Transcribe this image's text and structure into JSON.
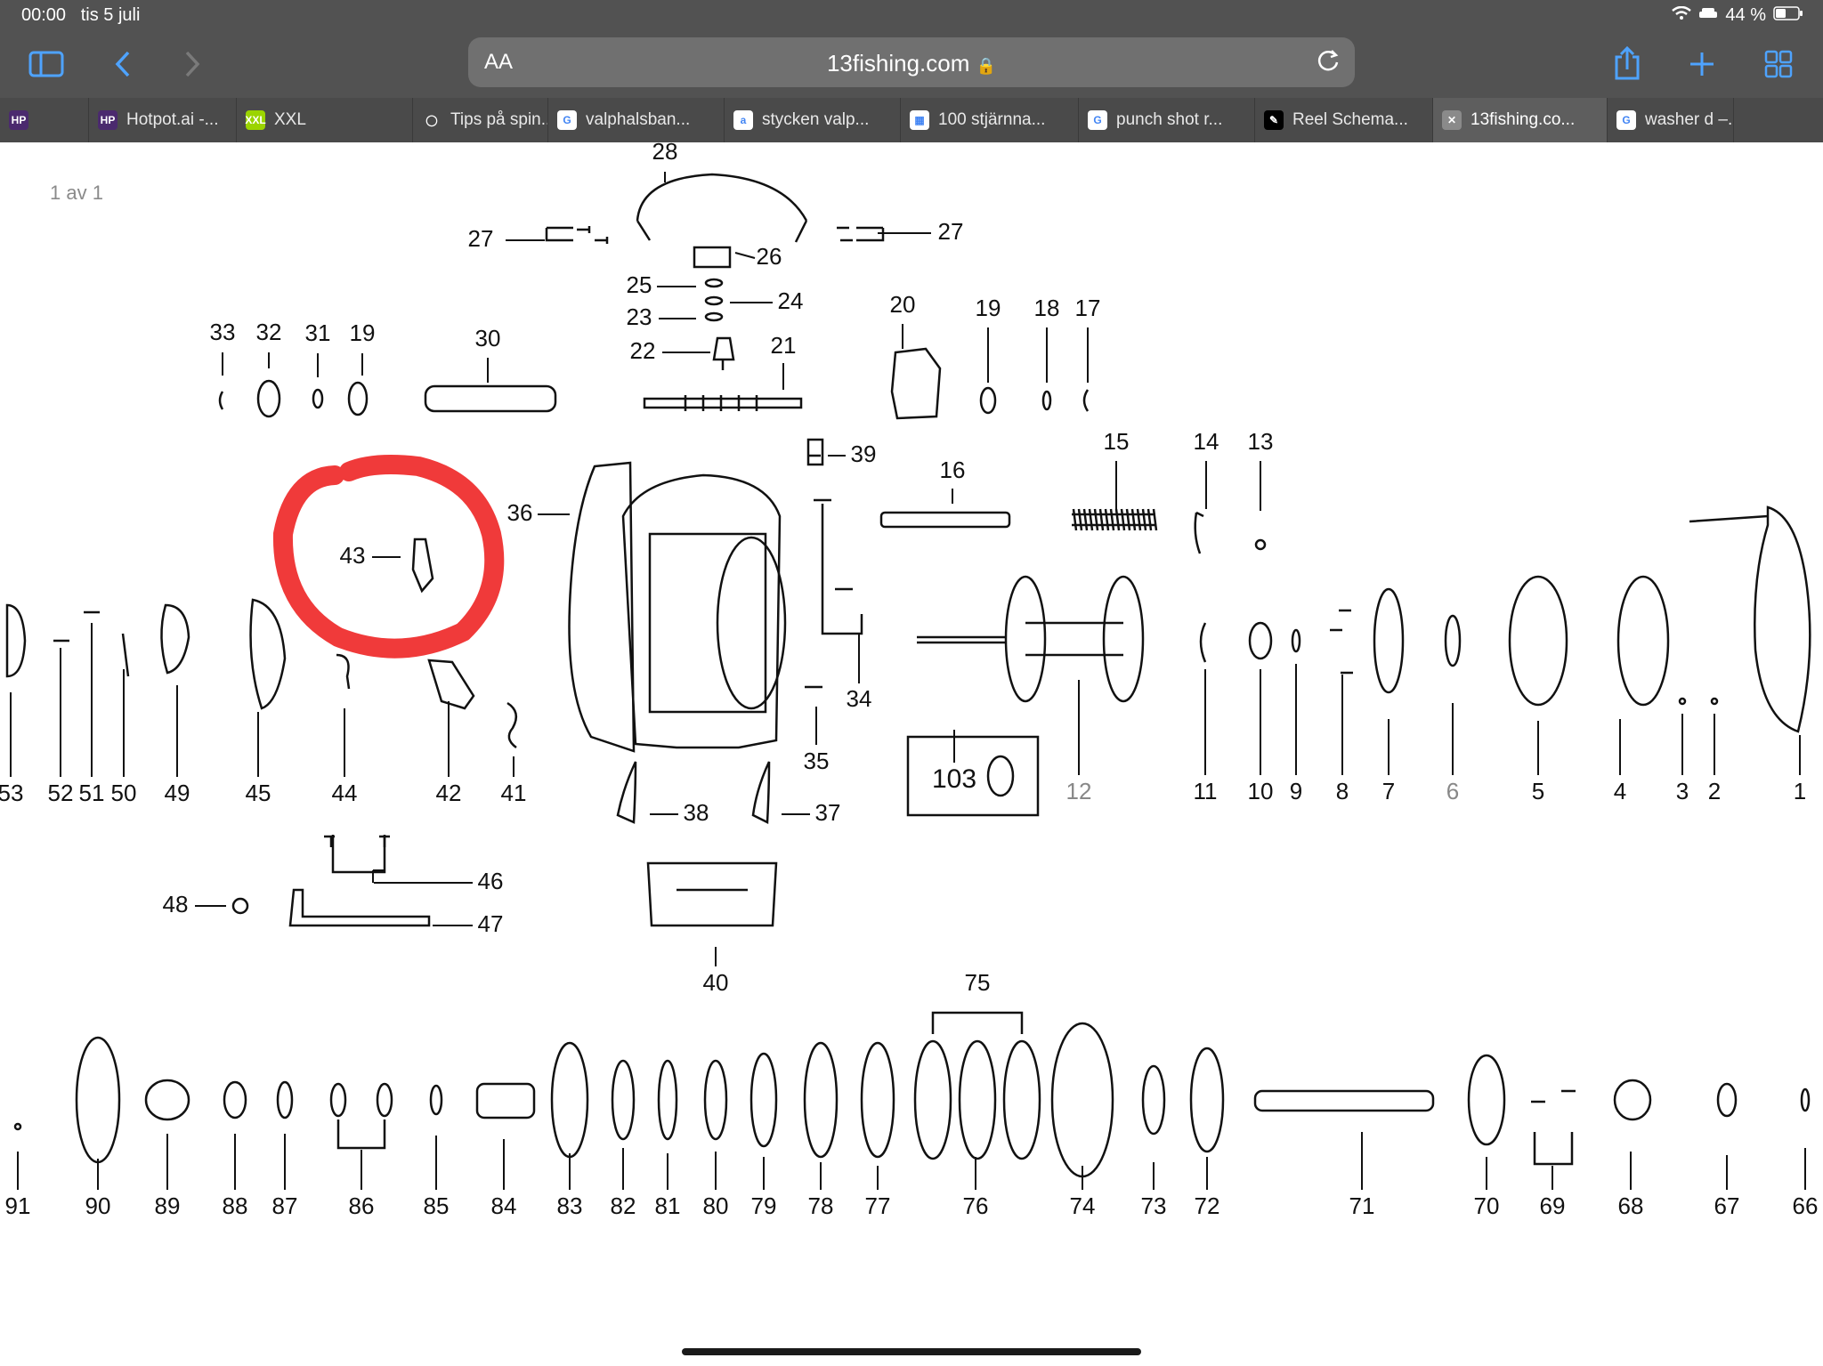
{
  "status": {
    "time": "00:00",
    "date": "tis 5 juli",
    "battery": "44 %"
  },
  "toolbar": {
    "sidebar_icon": "sidebar-icon",
    "back_icon": "chevron-left-icon",
    "forward_icon": "chevron-right-icon",
    "aa": "AA",
    "url": "13fishing.com",
    "share_icon": "share-icon",
    "new_tab_icon": "plus-icon",
    "tabs_icon": "grid-icon"
  },
  "tabs": [
    {
      "label": "",
      "favicon": "HP",
      "color": "#4b2a6e"
    },
    {
      "label": "Hotpot.ai -...",
      "favicon": "HP",
      "color": "#4b2a6e"
    },
    {
      "label": "XXL",
      "favicon": "XXL",
      "color": "#9bd400"
    },
    {
      "label": "Tips på spin...",
      "favicon": "◯",
      "color": "#4a4a4a"
    },
    {
      "label": "valphalsban...",
      "favicon": "G",
      "color": "#ffffff"
    },
    {
      "label": "stycken valp...",
      "favicon": "a",
      "color": "#ffffff"
    },
    {
      "label": "100 stjärnna...",
      "favicon": "▦",
      "color": "#ffffff"
    },
    {
      "label": "punch shot r...",
      "favicon": "G",
      "color": "#ffffff"
    },
    {
      "label": "Reel Schema...",
      "favicon": "✎",
      "color": "#000000"
    },
    {
      "label": "13fishing.co...",
      "favicon": "✕",
      "color": "#8a8a8a",
      "active": true
    },
    {
      "label": "washer d –...",
      "favicon": "G",
      "color": "#ffffff"
    }
  ],
  "page_counter": "1 av 1",
  "diagram": {
    "highlight_color": "#f03a3a",
    "labels": [
      "28",
      "27",
      "26",
      "25",
      "24",
      "23",
      "22",
      "21",
      "27",
      "20",
      "19",
      "18",
      "17",
      "33",
      "32",
      "31",
      "19",
      "30",
      "39",
      "15",
      "14",
      "13",
      "16",
      "36",
      "43",
      "34",
      "35",
      "53",
      "52",
      "51",
      "50",
      "49",
      "45",
      "44",
      "42",
      "41",
      "38",
      "37",
      "103",
      "12",
      "11",
      "10",
      "9",
      "8",
      "7",
      "6",
      "5",
      "4",
      "3",
      "2",
      "1",
      "46",
      "48",
      "47",
      "40",
      "75",
      "91",
      "90",
      "89",
      "88",
      "87",
      "86",
      "85",
      "84",
      "83",
      "82",
      "81",
      "80",
      "79",
      "78",
      "77",
      "76",
      "74",
      "73",
      "72",
      "71",
      "70",
      "69",
      "68",
      "67",
      "66"
    ]
  }
}
